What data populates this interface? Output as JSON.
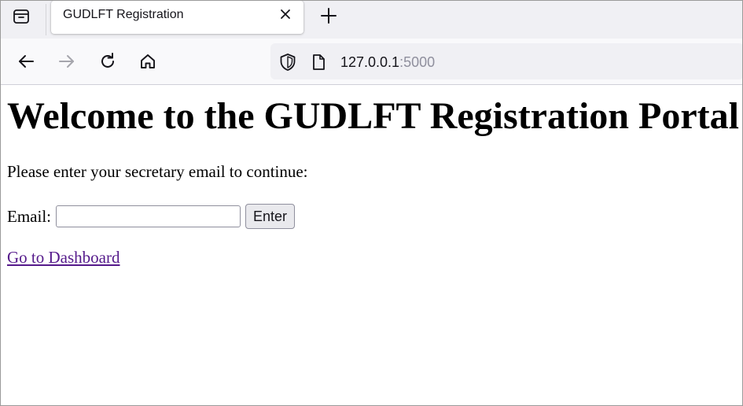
{
  "browser": {
    "tab": {
      "title": "GUDLFT Registration"
    },
    "url": {
      "host": "127.0.0.1",
      "port": ":5000"
    },
    "icons": {
      "tab_overview": "tab-overview-icon",
      "close": "close-icon",
      "new_tab": "plus-icon",
      "back": "back-arrow-icon",
      "forward": "forward-arrow-icon",
      "reload": "reload-icon",
      "home": "home-icon",
      "shield": "shield-icon",
      "page": "page-icon"
    }
  },
  "page": {
    "heading": "Welcome to the GUDLFT Registration Portal!",
    "prompt": "Please enter your secretary email to continue:",
    "form": {
      "email_label": "Email:",
      "email_value": "",
      "submit_label": "Enter"
    },
    "dashboard_link": "Go to Dashboard"
  },
  "colors": {
    "link_visited": "#551a8b",
    "tabstrip_bg": "#f0f0f4",
    "navbar_bg": "#f9f9fb"
  }
}
